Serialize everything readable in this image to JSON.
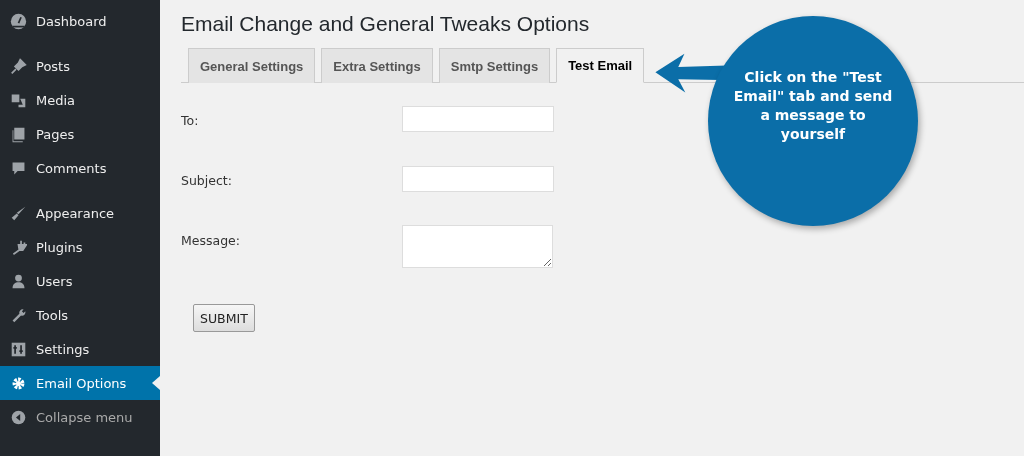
{
  "sidebar": {
    "groups": [
      {
        "items": [
          {
            "label": "Dashboard",
            "selected": false
          }
        ]
      },
      {
        "items": [
          {
            "label": "Posts",
            "selected": false
          },
          {
            "label": "Media",
            "selected": false
          },
          {
            "label": "Pages",
            "selected": false
          },
          {
            "label": "Comments",
            "selected": false
          }
        ]
      },
      {
        "items": [
          {
            "label": "Appearance",
            "selected": false
          },
          {
            "label": "Plugins",
            "selected": false
          },
          {
            "label": "Users",
            "selected": false
          },
          {
            "label": "Tools",
            "selected": false
          },
          {
            "label": "Settings",
            "selected": false
          },
          {
            "label": "Email Options",
            "selected": true
          }
        ]
      }
    ],
    "collapse": "Collapse menu"
  },
  "page": {
    "title": "Email Change and General Tweaks Options"
  },
  "tabs": [
    {
      "label": "General Settings",
      "selected": false
    },
    {
      "label": "Extra Settings",
      "selected": false
    },
    {
      "label": "Smtp Settings",
      "selected": false
    },
    {
      "label": "Test Email",
      "selected": true
    }
  ],
  "form": {
    "fields": [
      {
        "label": "To:",
        "kind": "input"
      },
      {
        "label": "Subject:",
        "kind": "input"
      },
      {
        "label": "Message:",
        "kind": "textarea"
      }
    ],
    "submit": "SUBMIT"
  },
  "callout": {
    "text": "Click on the \"Test Email\" tab and send a message to yourself"
  }
}
